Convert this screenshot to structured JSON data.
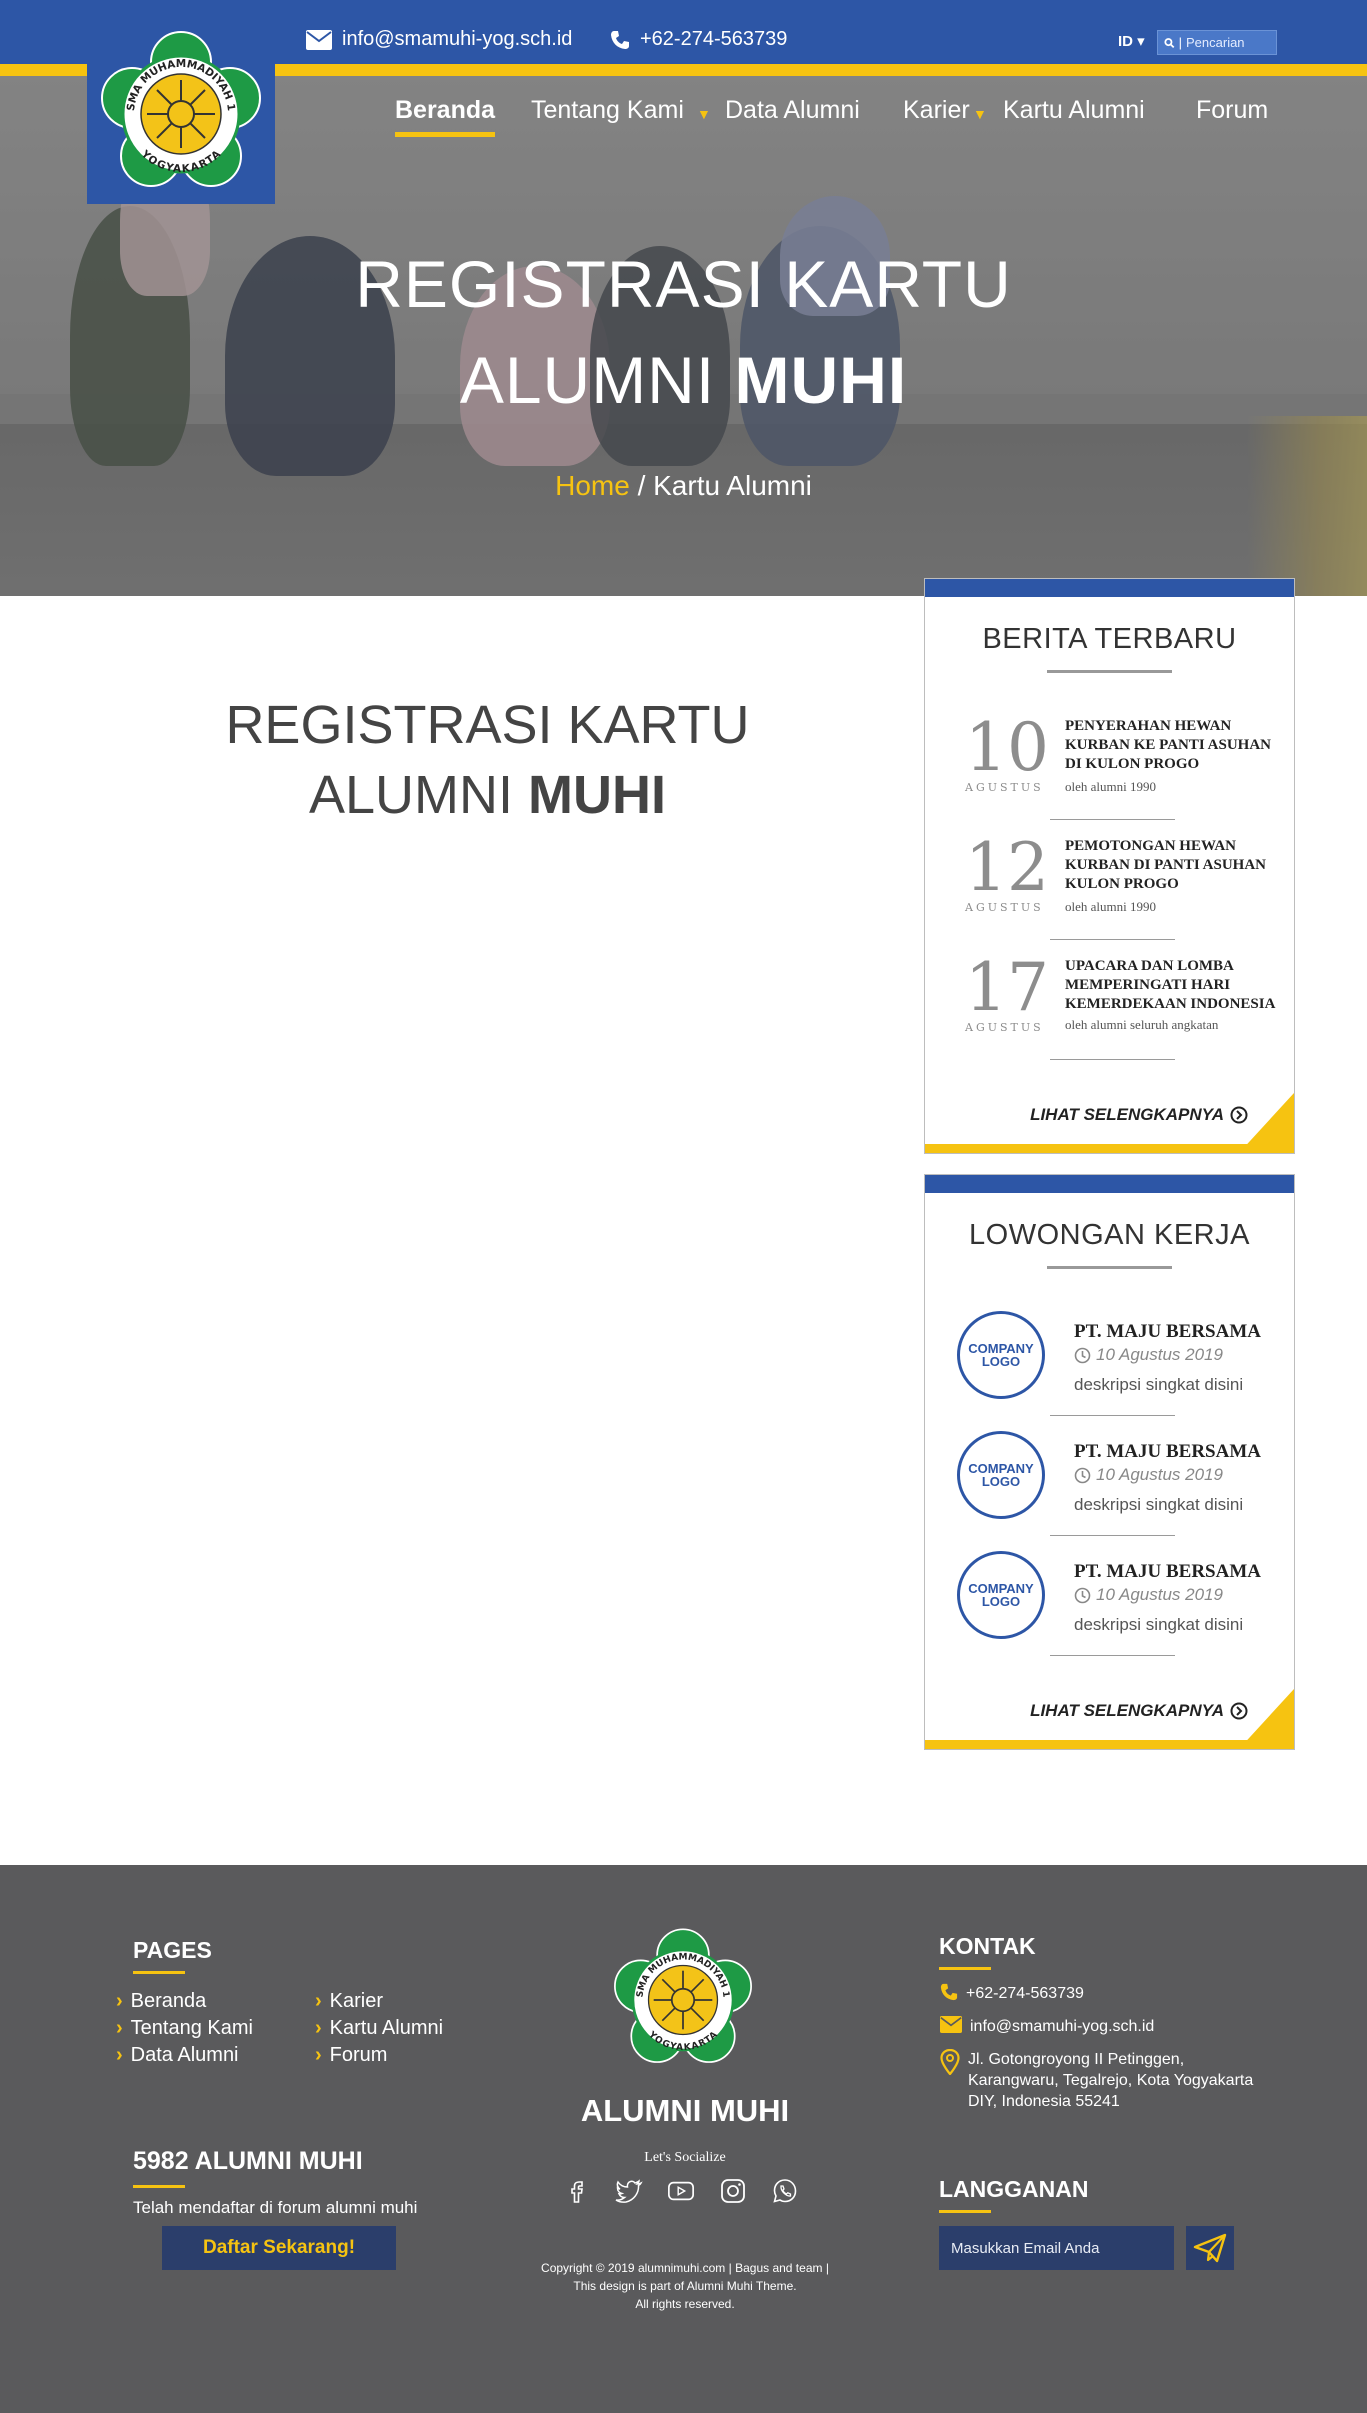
{
  "topbar": {
    "email": "info@smamuhi-yog.sch.id",
    "phone": "+62-274-563739",
    "lang": "ID ▾",
    "search_placeholder": "Pencarian"
  },
  "nav": {
    "items": [
      {
        "label": "Beranda",
        "active": true
      },
      {
        "label": "Tentang Kami",
        "dropdown": true
      },
      {
        "label": "Data Alumni"
      },
      {
        "label": "Karier",
        "dropdown": true
      },
      {
        "label": "Kartu Alumni"
      },
      {
        "label": "Forum"
      }
    ]
  },
  "logo": {
    "text_top": "SMA MUHAMMADIYAH 1",
    "text_bottom": "YOGYAKARTA"
  },
  "hero": {
    "title_line1": "REGISTRASI KARTU",
    "title_line2_light": "ALUMNI ",
    "title_line2_bold": "MUHI",
    "crumb_home": "Home",
    "crumb_rest": " / Kartu Alumni"
  },
  "main": {
    "title_line1": "REGISTRASI KARTU",
    "title_line2_light": "ALUMNI ",
    "title_line2_bold": "MUHI"
  },
  "news": {
    "title": "BERITA TERBARU",
    "items": [
      {
        "day": "10",
        "month": "AGUSTUS",
        "headline": "PENYERAHAN HEWAN KURBAN KE PANTI ASUHAN DI KULON PROGO",
        "by": "oleh alumni 1990"
      },
      {
        "day": "12",
        "month": "AGUSTUS",
        "headline": "PEMOTONGAN HEWAN KURBAN DI PANTI ASUHAN KULON PROGO",
        "by": "oleh alumni 1990"
      },
      {
        "day": "17",
        "month": "AGUSTUS",
        "headline": "UPACARA DAN LOMBA MEMPERINGATI HARI KEMERDEKAAN INDONESIA",
        "by": "oleh alumni seluruh angkatan"
      }
    ],
    "more": "LIHAT SELENGKAPNYA"
  },
  "jobs": {
    "title": "LOWONGAN KERJA",
    "items": [
      {
        "logo_line1": "COMPANY",
        "logo_line2": "LOGO",
        "name": "PT. MAJU BERSAMA",
        "date": "10 Agustus 2019",
        "desc": "deskripsi singkat disini"
      },
      {
        "logo_line1": "COMPANY",
        "logo_line2": "LOGO",
        "name": "PT. MAJU BERSAMA",
        "date": "10 Agustus 2019",
        "desc": "deskripsi singkat disini"
      },
      {
        "logo_line1": "COMPANY",
        "logo_line2": "LOGO",
        "name": "PT. MAJU BERSAMA",
        "date": "10 Agustus 2019",
        "desc": "deskripsi singkat disini"
      }
    ],
    "more": "LIHAT SELENGKAPNYA"
  },
  "footer": {
    "pages_title": "PAGES",
    "pages": [
      "Beranda",
      "Tentang Kami",
      "Data Alumni",
      "Karier",
      "Kartu Alumni",
      "Forum"
    ],
    "brand": "ALUMNI MUHI",
    "social_label": "Let's Socialize",
    "socials": [
      "facebook-icon",
      "twitter-icon",
      "youtube-icon",
      "instagram-icon",
      "whatsapp-icon"
    ],
    "copyright_1": "Copyright © 2019 alumnimuhi.com | Bagus and team |",
    "copyright_2": "This design is part of Alumni Muhi Theme.",
    "copyright_3": "All rights reserved.",
    "count_title": "5982 ALUMNI MUHI",
    "count_text": "Telah mendaftar di forum alumni muhi",
    "register_button": "Daftar Sekarang!",
    "contact_title": "KONTAK",
    "contact_phone": "+62-274-563739",
    "contact_email": "info@smamuhi-yog.sch.id",
    "contact_address": "Jl. Gotongroyong II Petinggen, Karangwaru, Tegalrejo, Kota Yogyakarta DIY, Indonesia 55241",
    "subscribe_title": "LANGGANAN",
    "subscribe_placeholder": "Masukkan Email Anda"
  },
  "colors": {
    "brand_blue": "#2d56a6",
    "accent_yellow": "#f6c311",
    "footer_bg": "#5a5a5c",
    "footer_input": "#2b3e6b"
  }
}
